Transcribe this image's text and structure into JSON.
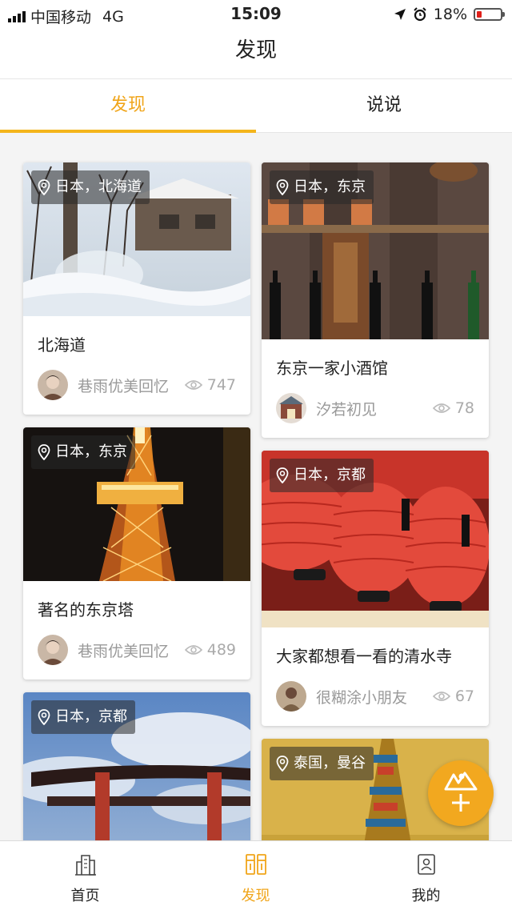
{
  "status_bar": {
    "carrier": "中国移动",
    "network": "4G",
    "time": "15:09",
    "battery": "18%",
    "battery_color": "#e0201a"
  },
  "header": {
    "title": "发现"
  },
  "tabs": [
    {
      "label": "发现",
      "active": true
    },
    {
      "label": "说说",
      "active": false
    }
  ],
  "accent_color": "#f4b51c",
  "posts": [
    {
      "location": "日本，北海道",
      "title": "北海道",
      "author": "巷雨优美回忆",
      "views": "747",
      "image": "snowy-village-photo"
    },
    {
      "location": "日本，东京",
      "title": "东京一家小酒馆",
      "author": "汐若初见",
      "views": "78",
      "image": "sake-bar-photo"
    },
    {
      "location": "日本，东京",
      "title": "著名的东京塔",
      "author": "巷雨优美回忆",
      "views": "489",
      "image": "tokyo-tower-photo"
    },
    {
      "location": "日本，京都",
      "title": "大家都想看一看的清水寺",
      "author": "很糊涂小朋友",
      "views": "67",
      "image": "red-lanterns-photo"
    },
    {
      "location": "日本，京都",
      "title": "",
      "author": "",
      "views": "",
      "image": "torii-gate-photo"
    },
    {
      "location": "泰国，曼谷",
      "title": "",
      "author": "",
      "views": "",
      "image": "golden-temple-photo"
    }
  ],
  "tabbar": [
    {
      "label": "首页",
      "icon": "building-icon",
      "active": false
    },
    {
      "label": "发现",
      "icon": "discover-icon",
      "active": true
    },
    {
      "label": "我的",
      "icon": "profile-card-icon",
      "active": false
    }
  ]
}
